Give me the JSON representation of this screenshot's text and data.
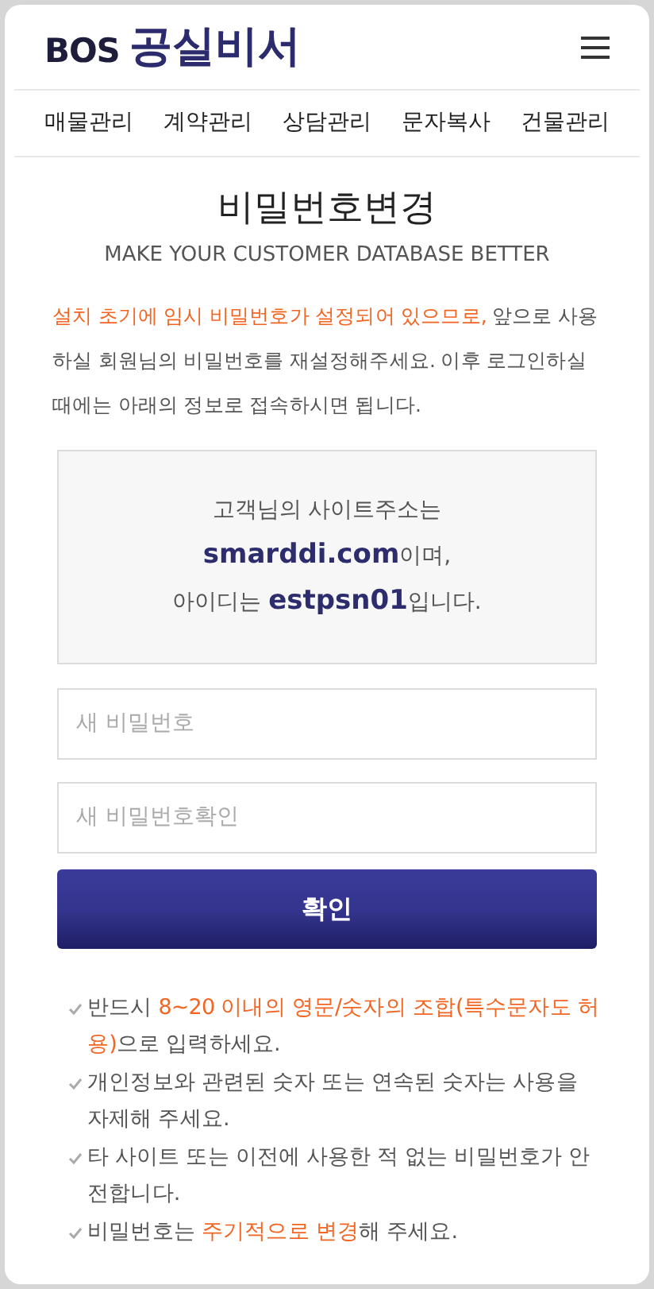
{
  "header": {
    "logo_mark": "BOS",
    "logo_text": "공실비서"
  },
  "nav": [
    {
      "label": "매물관리"
    },
    {
      "label": "계약관리"
    },
    {
      "label": "상담관리"
    },
    {
      "label": "문자복사"
    },
    {
      "label": "건물관리"
    }
  ],
  "title": "비밀번호변경",
  "subtitle": "MAKE YOUR CUSTOMER DATABASE BETTER",
  "intro": [
    {
      "text": "설치 초기에 임시 비밀번호가 설정되어 있으므로,",
      "highlight": true
    },
    {
      "text": " 앞으로 사용하실 회원님의 비밀번호를 재설정해주세요. 이후 로그인하실 때에는 아래의 정보로 접속하시면 됩니다.",
      "highlight": false
    }
  ],
  "info": [
    [
      {
        "text": "고객님의 사이트주소는",
        "strong": false
      }
    ],
    [
      {
        "text": "smarddi.com",
        "strong": true
      },
      {
        "text": "이며,",
        "strong": false
      }
    ],
    [
      {
        "text": "아이디는 ",
        "strong": false
      },
      {
        "text": "estpsn01",
        "strong": true
      },
      {
        "text": "입니다.",
        "strong": false
      }
    ]
  ],
  "fields": [
    {
      "placeholder": "새 비밀번호"
    },
    {
      "placeholder": "새 비밀번호확인"
    }
  ],
  "submit": "확인",
  "notes": [
    [
      {
        "text": "반드시 ",
        "highlight": false
      },
      {
        "text": "8~20 이내의 영문/숫자의 조합(특수문자도 허용)",
        "highlight": true
      },
      {
        "text": "으로 입력하세요.",
        "highlight": false
      }
    ],
    [
      {
        "text": "개인정보와 관련된 숫자 또는 연속된 숫자는 사용을 자제해 주세요.",
        "highlight": false
      }
    ],
    [
      {
        "text": "타 사이트 또는 이전에 사용한 적 없는 비밀번호가 안전합니다.",
        "highlight": false
      }
    ],
    [
      {
        "text": "비밀번호는 ",
        "highlight": false
      },
      {
        "text": "주기적으로 변경",
        "highlight": true
      },
      {
        "text": "해 주세요.",
        "highlight": false
      }
    ]
  ]
}
